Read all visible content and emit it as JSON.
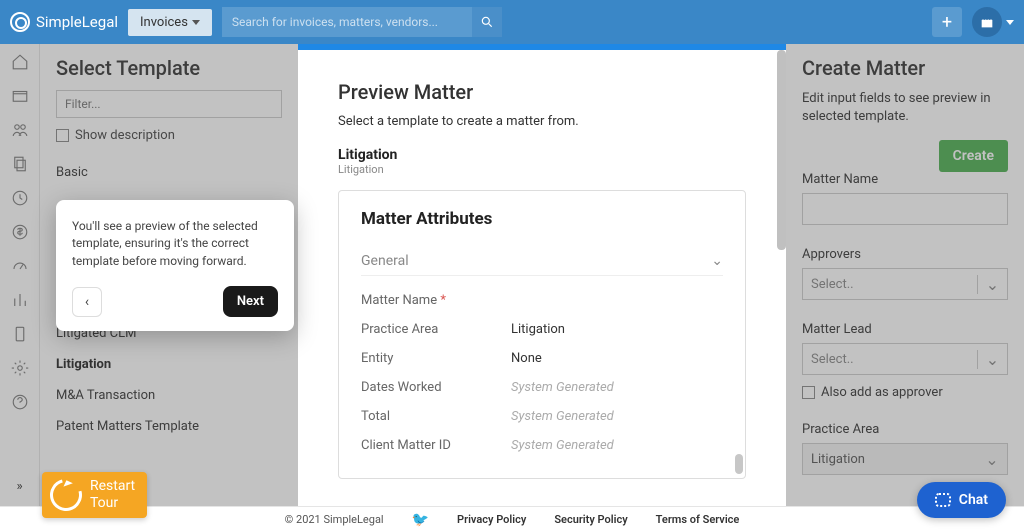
{
  "brand": "SimpleLegal",
  "topbar": {
    "dropdown_label": "Invoices",
    "search_placeholder": "Search for invoices, matters, vendors..."
  },
  "left_panel": {
    "title": "Select Template",
    "filter_placeholder": "Filter...",
    "show_desc_label": "Show description",
    "templates": [
      {
        "label": "Basic",
        "bold": false
      },
      {
        "label": "Litigated CLM",
        "bold": false
      },
      {
        "label": "Litigation",
        "bold": true
      },
      {
        "label": "M&A Transaction",
        "bold": false
      },
      {
        "label": "Patent Matters Template",
        "bold": false
      }
    ]
  },
  "tour": {
    "text": "You'll see a preview of the selected template, ensuring it's the correct template before moving forward.",
    "back_label": "‹",
    "next_label": "Next"
  },
  "middle_panel": {
    "title": "Preview Matter",
    "subtitle": "Select a template to create a matter from.",
    "section": "Litigation",
    "section_sub": "Litigation",
    "card_title": "Matter Attributes",
    "general_label": "General",
    "attributes": [
      {
        "label": "Matter Name",
        "value": "",
        "required": true,
        "generated": false
      },
      {
        "label": "Practice Area",
        "value": "Litigation",
        "required": false,
        "generated": false
      },
      {
        "label": "Entity",
        "value": "None",
        "required": false,
        "generated": false
      },
      {
        "label": "Dates Worked",
        "value": "System Generated",
        "required": false,
        "generated": true
      },
      {
        "label": "Total",
        "value": "System Generated",
        "required": false,
        "generated": true
      },
      {
        "label": "Client Matter ID",
        "value": "System Generated",
        "required": false,
        "generated": true
      }
    ]
  },
  "right_panel": {
    "title": "Create Matter",
    "subtitle": "Edit input fields to see preview in selected template.",
    "create_label": "Create",
    "fields": {
      "matter_name_label": "Matter Name",
      "approvers_label": "Approvers",
      "approvers_placeholder": "Select..",
      "matter_lead_label": "Matter Lead",
      "matter_lead_placeholder": "Select..",
      "also_add_label": "Also add as approver",
      "practice_area_label": "Practice Area",
      "practice_area_value": "Litigation"
    }
  },
  "restart_tour": {
    "line1": "Restart",
    "line2": "Tour"
  },
  "chat_label": "Chat",
  "footer": {
    "copyright": "© 2021 SimpleLegal",
    "links": [
      "Privacy Policy",
      "Security Policy",
      "Terms of Service"
    ]
  }
}
